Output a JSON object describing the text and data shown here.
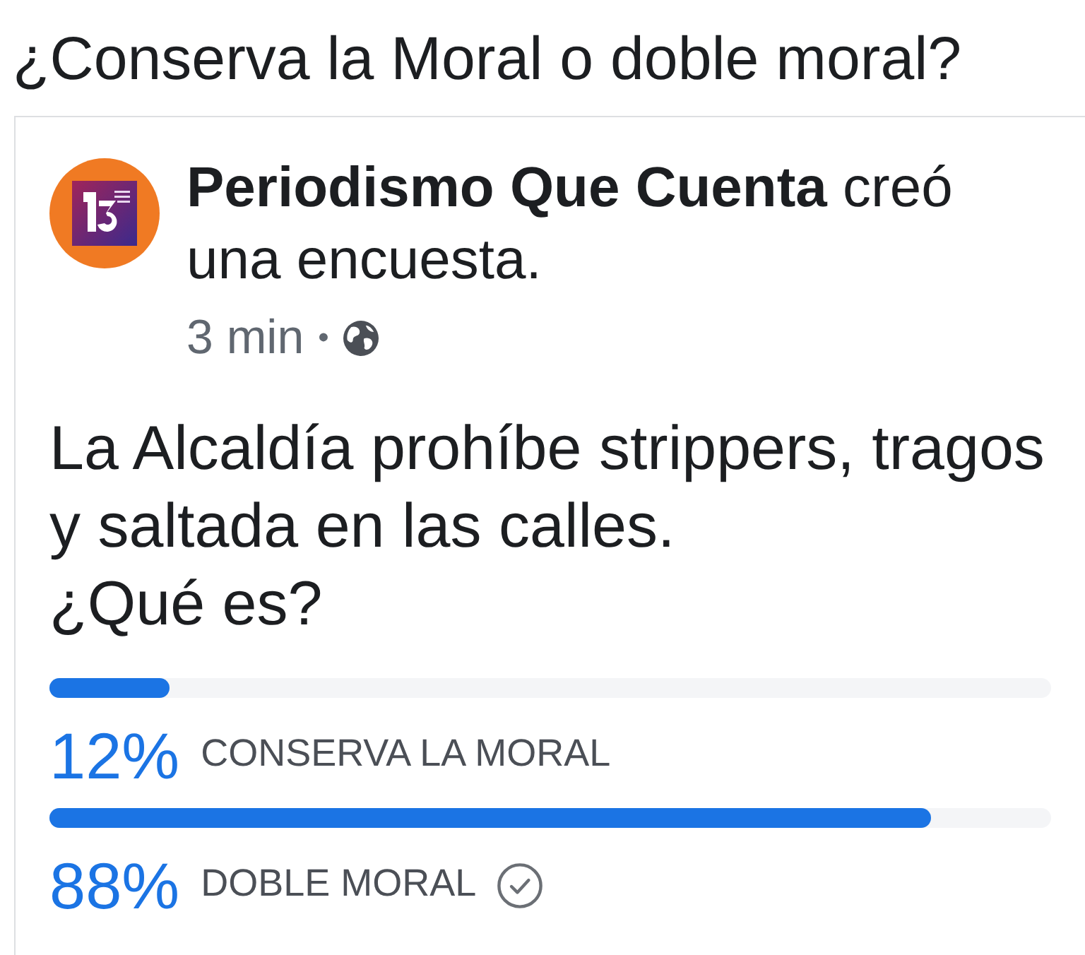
{
  "title": "¿Conserva la Moral o doble moral?",
  "post": {
    "header": "**Periodismo Que Cuenta** creó una encuesta.",
    "time": "3 min",
    "separator": "•"
  },
  "post_text": [
    "La Alcaldía prohíbe strippers, tragos y saltada en las calles.",
    "¿Qué es?"
  ],
  "poll": {
    "options": [
      {
        "percent": "12%",
        "label": "CONSERVA LA MORAL",
        "level": 0.12,
        "selected": false
      },
      {
        "percent": "88%",
        "label": "DOBLE MORAL",
        "level": 0.88,
        "selected": true
      }
    ]
  }
}
